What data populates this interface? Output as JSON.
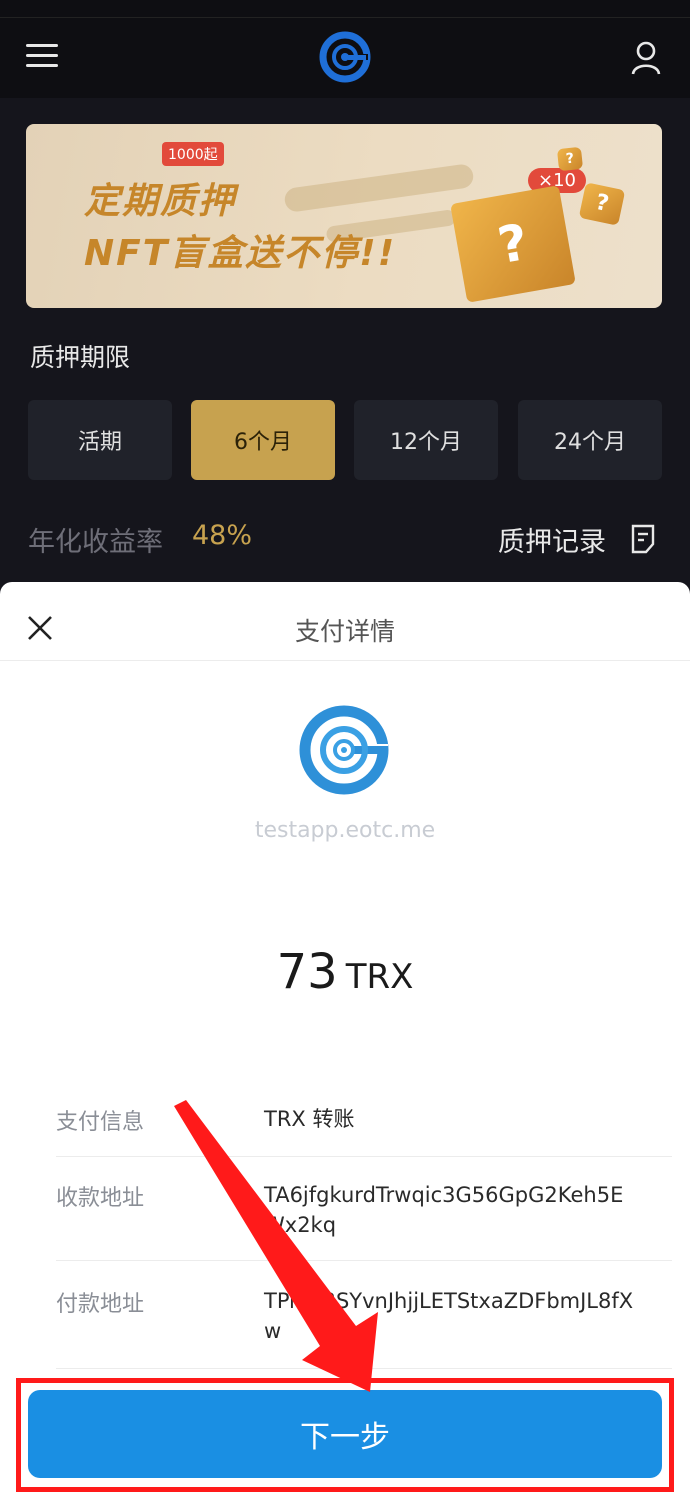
{
  "header": {
    "menu_icon": "hamburger-menu-icon",
    "logo_icon": "eotc-logo-icon",
    "user_icon": "user-profile-icon"
  },
  "banner": {
    "tag": "1000起",
    "line1": "定期质押",
    "line2": "NFT盲盒送不停!!",
    "multiplier": "×10",
    "box_glyph": "?"
  },
  "stake": {
    "title": "质押期限",
    "periods": [
      {
        "label": "活期",
        "active": false
      },
      {
        "label": "6个月",
        "active": true
      },
      {
        "label": "12个月",
        "active": false
      },
      {
        "label": "24个月",
        "active": false
      }
    ],
    "rate_label": "年化收益率",
    "rate_value": "48%",
    "records_label": "质押记录",
    "records_icon": "document-list-icon"
  },
  "payment": {
    "title": "支付详情",
    "close_icon": "close-icon",
    "domain": "testapp.eotc.me",
    "amount": "73",
    "unit": "TRX",
    "rows": [
      {
        "label": "支付信息",
        "value": "TRX 转账"
      },
      {
        "label": "收款地址",
        "value": "TA6jfgkurdTrwqic3G56GpG2Keh5EWx2kq"
      },
      {
        "label": "付款地址",
        "value": "TPi4Z3SYvnJhjjLETStxaZDFbmJL8fXw"
      }
    ],
    "next_button": "下一步"
  },
  "colors": {
    "accent_gold": "#c7a24f",
    "primary_blue": "#1a8fe3",
    "highlight_red": "#ff1a1a"
  }
}
